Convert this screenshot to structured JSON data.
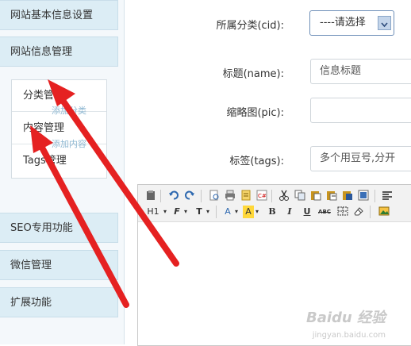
{
  "sidebar": {
    "items": [
      {
        "label": "网站基本信息设置"
      },
      {
        "label": "网站信息管理"
      },
      {
        "label": "SEO专用功能"
      },
      {
        "label": "微信管理"
      },
      {
        "label": "扩展功能"
      }
    ],
    "submenu": [
      {
        "label": "分类管理",
        "ghost": "添加分类"
      },
      {
        "label": "内容管理",
        "ghost": "添加内容"
      },
      {
        "label": "Tags管理"
      }
    ]
  },
  "form": {
    "category_label": "所属分类(cid):",
    "category_value": "----请选择",
    "title_label": "标题(name):",
    "title_value": "信息标题",
    "pic_label": "缩略图(pic):",
    "pic_value": "",
    "tags_label": "标签(tags):",
    "tags_value": "多个用豆号,分开"
  },
  "editor": {
    "row2": [
      "H1",
      "F",
      "T",
      "A",
      "A",
      "B",
      "I",
      "U",
      "ABC"
    ]
  },
  "watermark": {
    "text": "Baidu 经验",
    "sub": "jingyan.baidu.com"
  }
}
